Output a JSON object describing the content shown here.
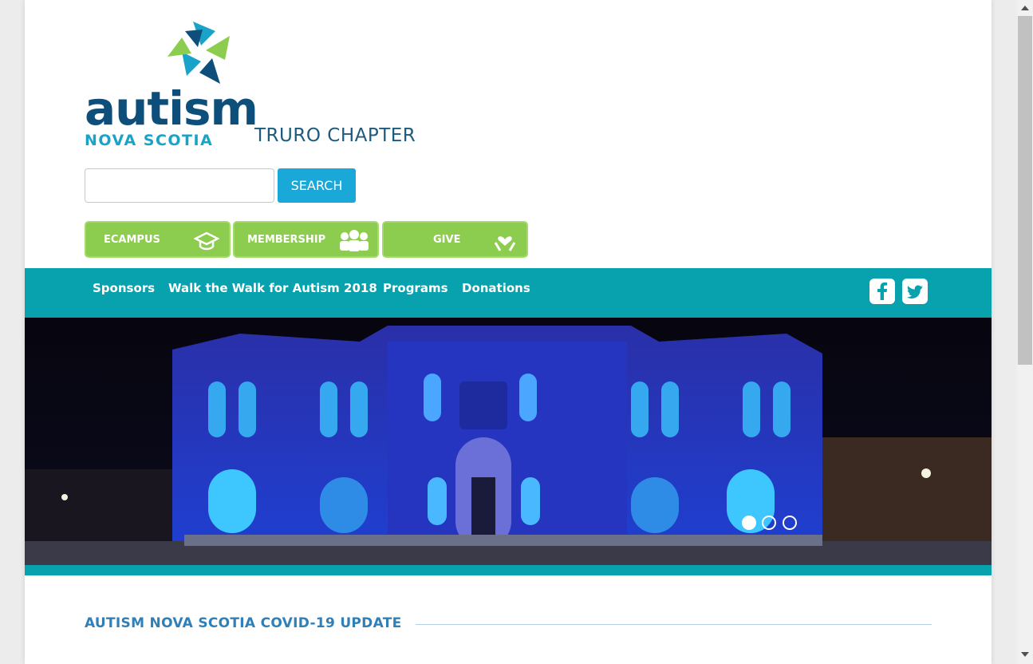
{
  "header": {
    "logo_word": "autism",
    "logo_sub": "NOVA SCOTIA",
    "chapter": "TRURO CHAPTER"
  },
  "search": {
    "placeholder": "",
    "button_label": "SEARCH"
  },
  "quick_links": [
    {
      "label": "ECAMPUS",
      "icon": "graduation-cap-icon"
    },
    {
      "label": "MEMBERSHIP",
      "icon": "people-icon"
    },
    {
      "label": "GIVE",
      "icon": "heart-hands-icon"
    }
  ],
  "nav": {
    "items": [
      "Sponsors",
      "Walk the Walk for Autism 2018",
      "Programs",
      "Donations"
    ],
    "social": [
      "facebook-icon",
      "twitter-icon"
    ]
  },
  "slider": {
    "image": "illuminated-building-blue-night",
    "active_index": 0,
    "count": 3
  },
  "section": {
    "title": "AUTISM NOVA SCOTIA COVID-19 UPDATE"
  },
  "colors": {
    "nav_bg": "#07a2ad",
    "search_btn": "#1aa8d8",
    "quick_link_bg": "#8ccc4e",
    "logo_navy": "#0d4f7a",
    "logo_teal": "#1aa3c9",
    "section_title": "#2f7fb9"
  }
}
